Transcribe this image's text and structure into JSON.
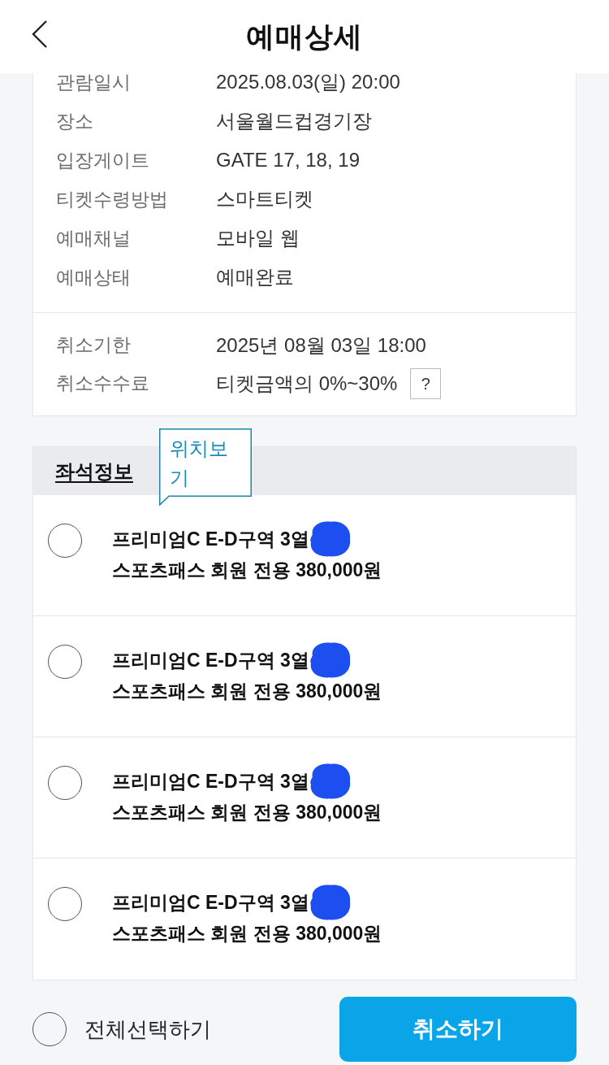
{
  "header": {
    "title": "예매상세"
  },
  "booking_info": [
    {
      "label": "관람일시",
      "value": "2025.08.03(일) 20:00"
    },
    {
      "label": "장소",
      "value": "서울월드컵경기장"
    },
    {
      "label": "입장게이트",
      "value": "GATE 17, 18, 19"
    },
    {
      "label": "티켓수령방법",
      "value": "스마트티켓"
    },
    {
      "label": "예매채널",
      "value": "모바일 웹"
    },
    {
      "label": "예매상태",
      "value": "예매완료"
    }
  ],
  "cancellation_info": [
    {
      "label": "취소기한",
      "value": "2025년 08월 03일 18:00"
    },
    {
      "label": "취소수수료",
      "value": "티켓금액의 0%~30%",
      "help_button": "?"
    }
  ],
  "seat_section": {
    "title": "좌석정보",
    "location_tooltip": "위치보기",
    "seats": [
      {
        "line_1": "프리미엄C E-D구역 3열",
        "line_2": "스포츠패스 회원 전용 380,000원",
        "selected": false,
        "redacted": true
      },
      {
        "line_1": "프리미엄C E-D구역 3열",
        "line_2": "스포츠패스 회원 전용 380,000원",
        "selected": false,
        "redacted": true
      },
      {
        "line_1": "프리미엄C E-D구역 3열",
        "line_2": "스포츠패스 회원 전용 380,000원",
        "selected": false,
        "redacted": true
      },
      {
        "line_1": "프리미엄C E-D구역 3열",
        "line_2": "스포츠패스 회원 전용 380,000원",
        "selected": false,
        "redacted": true
      }
    ]
  },
  "footer": {
    "select_all": {
      "label": "전체선택하기",
      "checked": false
    },
    "cancel_button": "취소하기"
  }
}
